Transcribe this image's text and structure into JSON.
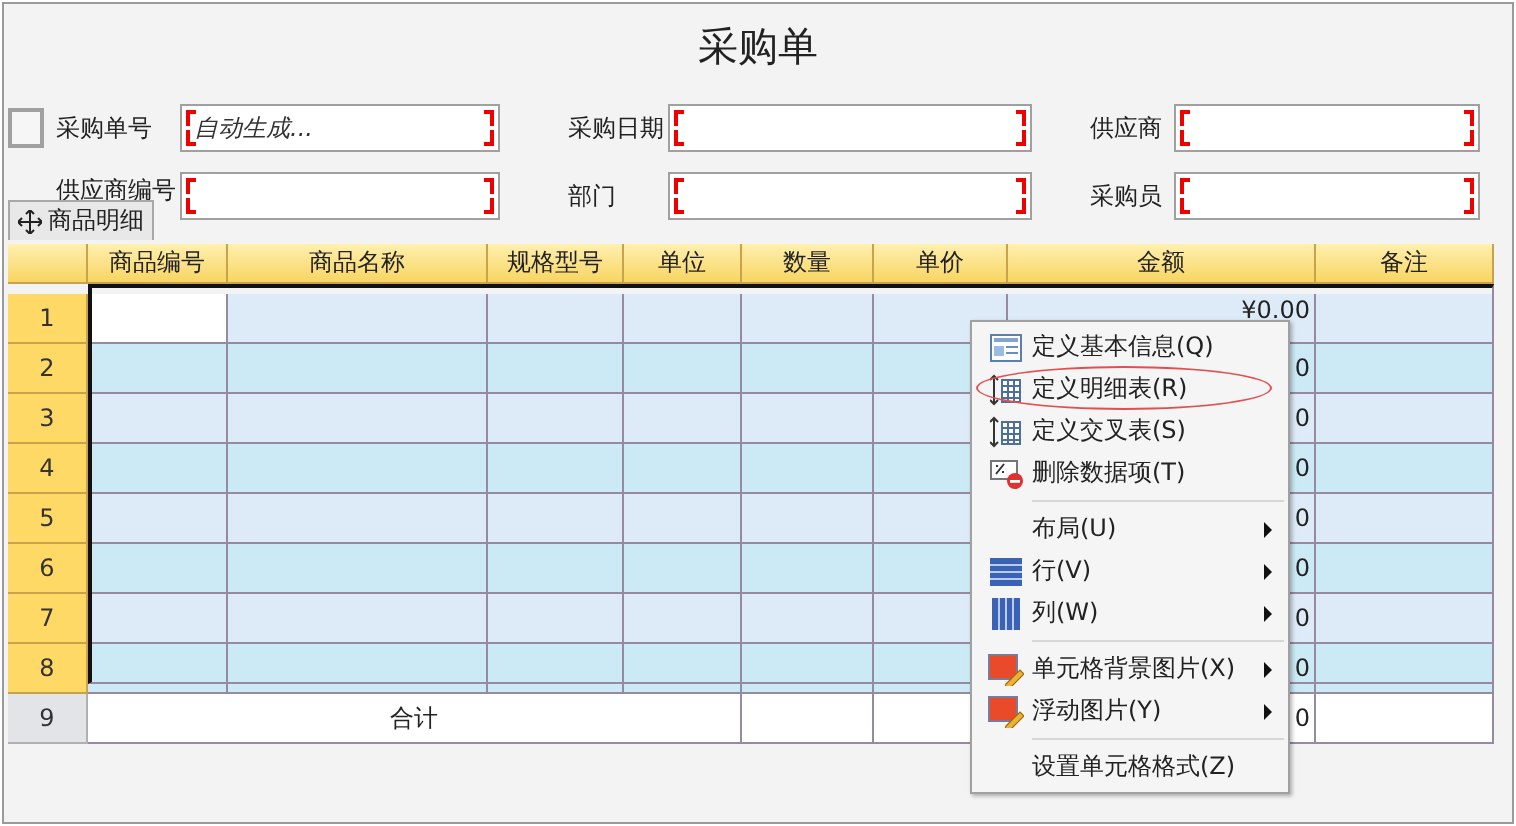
{
  "title": "采购单",
  "form": {
    "checkbox": {
      "checked": false
    },
    "rows": [
      [
        {
          "label": "采购单号",
          "value": "自动生成..."
        },
        {
          "label": "采购日期"
        },
        {
          "label": "供应商"
        }
      ],
      [
        {
          "label": "供应商编号"
        },
        {
          "label": "部门"
        },
        {
          "label": "采购员"
        }
      ]
    ]
  },
  "section_tab": {
    "label": "商品明细"
  },
  "table": {
    "columns": [
      "商品编号",
      "商品名称",
      "规格型号",
      "单位",
      "数量",
      "单价",
      "金额",
      "备注"
    ],
    "rows": [
      {
        "number": "1",
        "amount": "¥0.00",
        "selected": true
      },
      {
        "number": "2",
        "amount": "0",
        "selected": false
      },
      {
        "number": "3",
        "amount": "0",
        "selected": false
      },
      {
        "number": "4",
        "amount": "0",
        "selected": false
      },
      {
        "number": "5",
        "amount": "0",
        "selected": false
      },
      {
        "number": "6",
        "amount": "0",
        "selected": false
      },
      {
        "number": "7",
        "amount": "0",
        "selected": false
      },
      {
        "number": "8",
        "amount": "0",
        "selected": false
      }
    ],
    "total_row": {
      "number": "9",
      "label": "合计",
      "amount": "0"
    }
  },
  "context_menu": {
    "groups": [
      [
        {
          "label": "定义基本信息(Q)",
          "submenu": false,
          "circled": false
        },
        {
          "label": "定义明细表(R)",
          "submenu": false,
          "circled": true
        },
        {
          "label": "定义交叉表(S)",
          "submenu": false,
          "circled": false
        },
        {
          "label": "删除数据项(T)",
          "submenu": false,
          "circled": false
        }
      ],
      [
        {
          "label": "布局(U)",
          "submenu": true,
          "circled": false
        },
        {
          "label": "行(V)",
          "submenu": true,
          "circled": false
        },
        {
          "label": "列(W)",
          "submenu": true,
          "circled": false
        }
      ],
      [
        {
          "label": "单元格背景图片(X)",
          "submenu": true,
          "circled": false
        },
        {
          "label": "浮动图片(Y)",
          "submenu": true,
          "circled": false
        }
      ],
      [
        {
          "label": "设置单元格格式(Z)",
          "submenu": false,
          "circled": false
        }
      ]
    ]
  }
}
